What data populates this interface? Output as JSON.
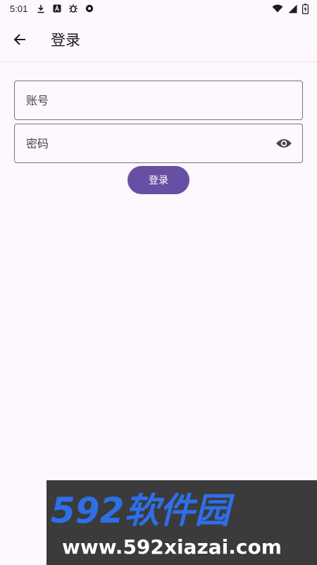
{
  "status_bar": {
    "time": "5:01",
    "icons_left": [
      "download-icon",
      "a-box-icon",
      "bug-icon",
      "record-icon"
    ],
    "icons_right": [
      "wifi-icon",
      "signal-icon",
      "battery-charging-icon"
    ]
  },
  "app_bar": {
    "back_icon": "arrow-left-icon",
    "title": "登录"
  },
  "form": {
    "account": {
      "placeholder": "账号",
      "value": ""
    },
    "password": {
      "placeholder": "密码",
      "value": "",
      "toggle_icon": "eye-icon"
    },
    "login_label": "登录"
  },
  "watermark": {
    "logo_text": "592软件园",
    "url": "www.592xiazai.com"
  },
  "colors": {
    "background": "#FDF8FD",
    "primary": "#6750A4",
    "outline": "#79747E",
    "watermark_bg": "#3B3B3B",
    "watermark_blue": "#2E6FE8"
  }
}
